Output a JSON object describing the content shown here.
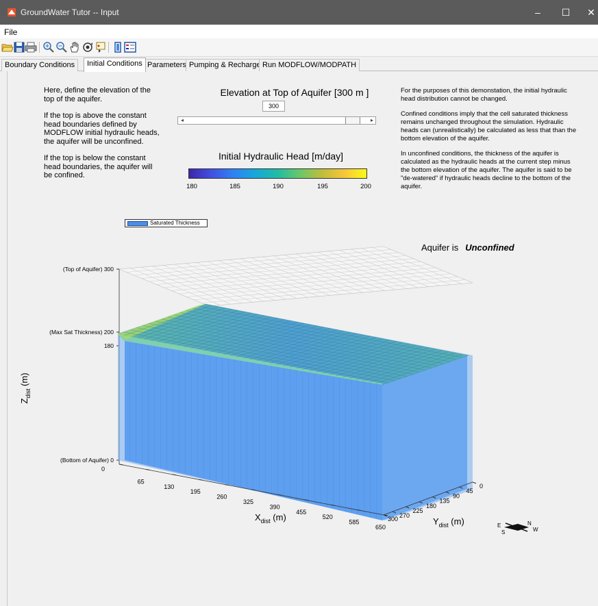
{
  "window": {
    "title": "GroundWater Tutor -- Input",
    "minimize": "–",
    "maximize": "☐",
    "close": "✕"
  },
  "menu": {
    "file": "File"
  },
  "toolbar": {
    "icons": [
      "open-icon",
      "save-icon",
      "print-icon",
      "zoom-in-icon",
      "zoom-out-icon",
      "pan-icon",
      "rotate-icon",
      "data-cursor-icon",
      "colorbar-icon",
      "legend-icon"
    ]
  },
  "tabs": [
    {
      "label": "Boundary Conditions"
    },
    {
      "label": "Initial Conditions",
      "active": true
    },
    {
      "label": "Parameters"
    },
    {
      "label": "Pumping & Recharge"
    },
    {
      "label": "Run MODFLOW/MODPATH"
    }
  ],
  "left_text": {
    "p1": "Here, define the elevation of the top of the aquifer.",
    "p2": "If the top is above the constant head boundaries defined by MODFLOW initial hydraulic heads, the aquifer will be unconfined.",
    "p3": "If the top is below the constant head boundaries, the aquifer will be confined."
  },
  "right_text": {
    "p1": "For the purposes of this demonstation, the initial hydraulic head distribution cannot be changed.",
    "p2": "Confined conditions imply that the cell saturated thickness remains unchanged throughout the simulation. Hydraulic heads can (unrealistically) be calculated as less that than the bottom elevation of the aquifer.",
    "p3": "In unconfined conditions, the thickness of the aquifer is calculated as the hydraulic heads at the current step minus the bottom elevation of the aquifer. The aquifer is said to be \"de-watered\" if hydraulic heads decline to the bottom of the aquifer."
  },
  "elevation": {
    "title": "Elevation at Top of Aquifer  [300 m ]",
    "value": "300",
    "slider_fraction": 0.95
  },
  "colorbar": {
    "title": "Initial Hydraulic Head  [m/day]",
    "ticks": [
      "180",
      "185",
      "190",
      "195",
      "200"
    ]
  },
  "legend": {
    "label": "Saturated Thickness"
  },
  "status": {
    "prefix": "Aquifer is",
    "value": "Unconfined"
  },
  "plot": {
    "z_ticks": [
      {
        "label": "(Top of Aquifer)  300"
      },
      {
        "label": "(Max Sat Thickness)  200"
      },
      {
        "label": "180"
      },
      {
        "label": "(Bottom of Aquifer)  0"
      }
    ],
    "x_ticks": [
      "0",
      "65",
      "130",
      "195",
      "260",
      "325",
      "390",
      "455",
      "520",
      "585",
      "650"
    ],
    "y_ticks": [
      "0",
      "45",
      "90",
      "135",
      "180",
      "225",
      "270",
      "300"
    ],
    "xlabel": "X",
    "xlabel_sub": "dist",
    "xlabel_unit": " (m)",
    "ylabel": "Y",
    "ylabel_sub": "dist",
    "ylabel_unit": " (m)",
    "zlabel": "Z",
    "zlabel_sub": "dist",
    "zlabel_unit": " (m)"
  },
  "compass": {
    "e": "E",
    "s": "S",
    "n": "N",
    "w": "W"
  }
}
